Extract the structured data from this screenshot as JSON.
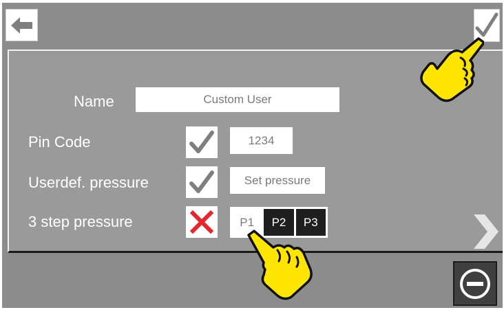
{
  "header": {
    "back_icon": "arrow-left-icon",
    "confirm_icon": "checkmark-icon"
  },
  "form": {
    "name_label": "Name",
    "name_value": "Custom User",
    "pin_label": "Pin Code",
    "pin_checked": true,
    "pin_value": "1234",
    "userdef_label": "Userdef. pressure",
    "userdef_checked": true,
    "set_pressure_label": "Set pressure",
    "step_label": "3 step pressure",
    "step_checked": false,
    "steps": [
      "P1",
      "P2",
      "P3"
    ],
    "selected_step": "P1"
  },
  "footer": {
    "next_icon": "chevron-right-icon",
    "stop_icon": "minus-circle-icon"
  },
  "overlay": {
    "hand_icon": "pointing-hand-icon"
  },
  "colors": {
    "background": "#8c8c8c",
    "panel": "#9a9a9a",
    "check": "#7f7f7f",
    "cross": "#e0282e",
    "hand_fill": "#ffe600",
    "hand_outline": "#111111",
    "stop_button": "#404040"
  }
}
